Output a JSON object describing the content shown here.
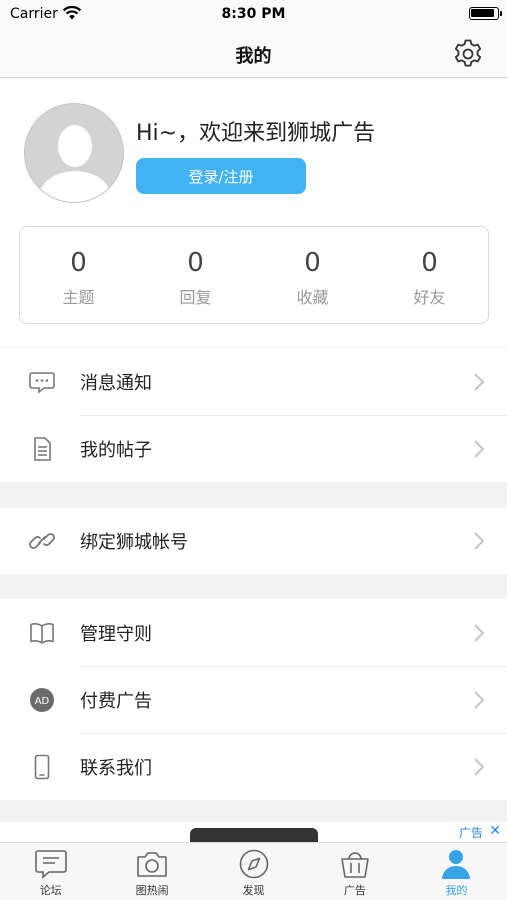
{
  "status_bar": {
    "carrier": "Carrier",
    "time": "8:30 PM"
  },
  "nav": {
    "title": "我的",
    "settings_icon": "gear-icon"
  },
  "profile": {
    "greeting": "Hi~，欢迎来到狮城广告",
    "login_button": "登录/注册",
    "accent_color": "#41b3f0"
  },
  "stats": [
    {
      "value": "0",
      "label": "主题"
    },
    {
      "value": "0",
      "label": "回复"
    },
    {
      "value": "0",
      "label": "收藏"
    },
    {
      "value": "0",
      "label": "好友"
    }
  ],
  "menu": {
    "group1": [
      {
        "label": "消息通知",
        "icon": "message-icon"
      },
      {
        "label": "我的帖子",
        "icon": "document-icon"
      }
    ],
    "group2": [
      {
        "label": "绑定狮城帐号",
        "icon": "link-icon"
      }
    ],
    "group3": [
      {
        "label": "管理守则",
        "icon": "book-icon"
      },
      {
        "label": "付费广告",
        "icon": "ad-icon",
        "icon_text": "AD"
      },
      {
        "label": "联系我们",
        "icon": "phone-icon"
      }
    ]
  },
  "ad_banner": {
    "tag": "广告",
    "close": "✕"
  },
  "tabs": [
    {
      "label": "论坛",
      "icon": "chat-icon",
      "active": false
    },
    {
      "label": "图热闹",
      "icon": "camera-icon",
      "active": false
    },
    {
      "label": "发现",
      "icon": "compass-icon",
      "active": false
    },
    {
      "label": "广告",
      "icon": "basket-icon",
      "active": false
    },
    {
      "label": "我的",
      "icon": "person-icon",
      "active": true
    }
  ],
  "colors": {
    "tab_active": "#36a3e6",
    "background": "#f2f2f2"
  }
}
